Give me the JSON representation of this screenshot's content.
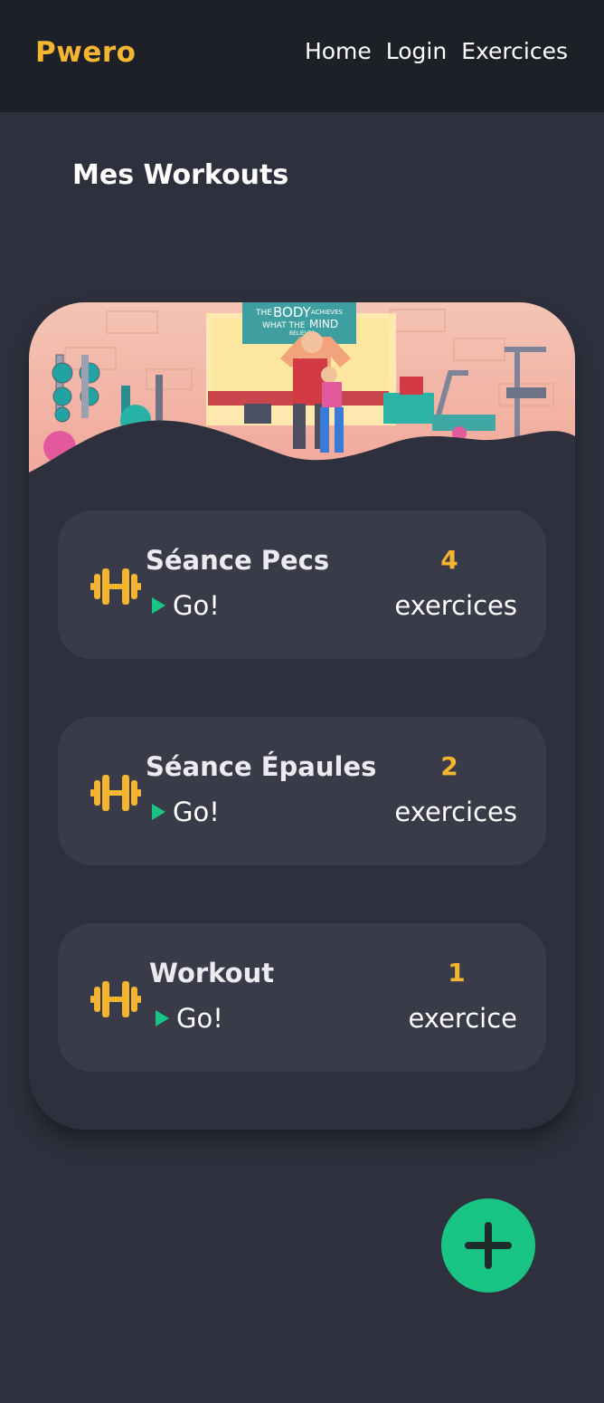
{
  "app": {
    "brand": "Pwero"
  },
  "nav": {
    "links": [
      "Home",
      "Login",
      "Exercices"
    ]
  },
  "page": {
    "title": "Mes Workouts"
  },
  "hero": {
    "banner_text": [
      "THE",
      "BODY",
      "ACHIEVES",
      "WHAT THE",
      "MIND",
      "BELIEVES"
    ]
  },
  "workouts": [
    {
      "name": "Séance Pecs",
      "go": "Go!",
      "count": "4",
      "unit": "exercices"
    },
    {
      "name": "Séance Épaules",
      "go": "Go!",
      "count": "2",
      "unit": "exercices"
    },
    {
      "name": "Workout",
      "go": "Go!",
      "count": "1",
      "unit": "exercice"
    }
  ],
  "icons": {
    "workout": "dumbbell-icon",
    "go": "play-icon",
    "add": "plus-icon"
  },
  "colors": {
    "accent": "#f4b631",
    "go": "#17c484",
    "fab": "#17c484",
    "background": "#2e313d",
    "navbar": "#1e2028",
    "item": "#3a3b48"
  }
}
